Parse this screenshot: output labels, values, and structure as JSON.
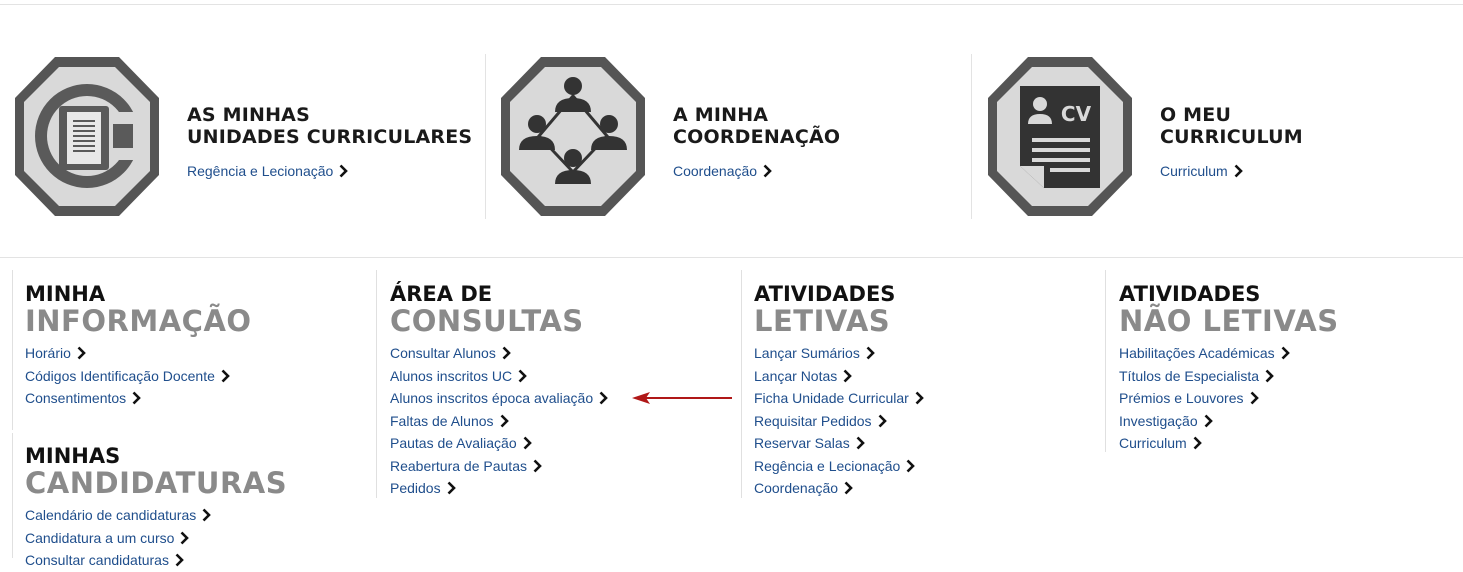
{
  "hero": [
    {
      "title_line1": "AS MINHAS",
      "title_line2": "UNIDADES CURRICULARES",
      "link": "Regência e Lecionação",
      "icon": "book-icon"
    },
    {
      "title_line1": "A MINHA",
      "title_line2": "COORDENAÇÃO",
      "link": "Coordenação",
      "icon": "people-network-icon"
    },
    {
      "title_line1": "O MEU",
      "title_line2": "CURRICULUM",
      "link": "Curriculum",
      "icon": "cv-document-icon",
      "icon_text": "CV"
    }
  ],
  "sections": {
    "info": {
      "line1": "MINHA",
      "line2": "INFORMAÇÃO",
      "items": [
        "Horário",
        "Códigos Identificação Docente",
        "Consentimentos"
      ]
    },
    "cand": {
      "line1": "MINHAS",
      "line2": "CANDIDATURAS",
      "items": [
        "Calendário de candidaturas",
        "Candidatura a um curso",
        "Consultar candidaturas"
      ]
    },
    "consultas": {
      "line1": "ÁREA DE",
      "line2": "CONSULTAS",
      "items": [
        "Consultar Alunos",
        "Alunos inscritos UC",
        "Alunos inscritos época avaliação",
        "Faltas de Alunos",
        "Pautas de Avaliação",
        "Reabertura de Pautas",
        "Pedidos"
      ]
    },
    "letivas": {
      "line1": "ATIVIDADES",
      "line2": "LETIVAS",
      "items": [
        "Lançar Sumários",
        "Lançar Notas",
        "Ficha Unidade Curricular",
        "Requisitar Pedidos",
        "Reservar Salas",
        "Regência e Lecionação",
        "Coordenação"
      ]
    },
    "naoletivas": {
      "line1": "ATIVIDADES",
      "line2": "NÃO LETIVAS",
      "items": [
        "Habilitações Académicas",
        "Títulos de Especialista",
        "Prémios e Louvores",
        "Investigação",
        "Curriculum"
      ]
    }
  },
  "colors": {
    "link": "#1f4e8c",
    "heading_gray": "#8a8a8a",
    "icon_dark": "#555555",
    "icon_light": "#d8d8d8",
    "arrow": "#b01818"
  },
  "annotation": {
    "icon": "red-arrow-icon",
    "points_to": "Alunos inscritos época avaliação"
  }
}
